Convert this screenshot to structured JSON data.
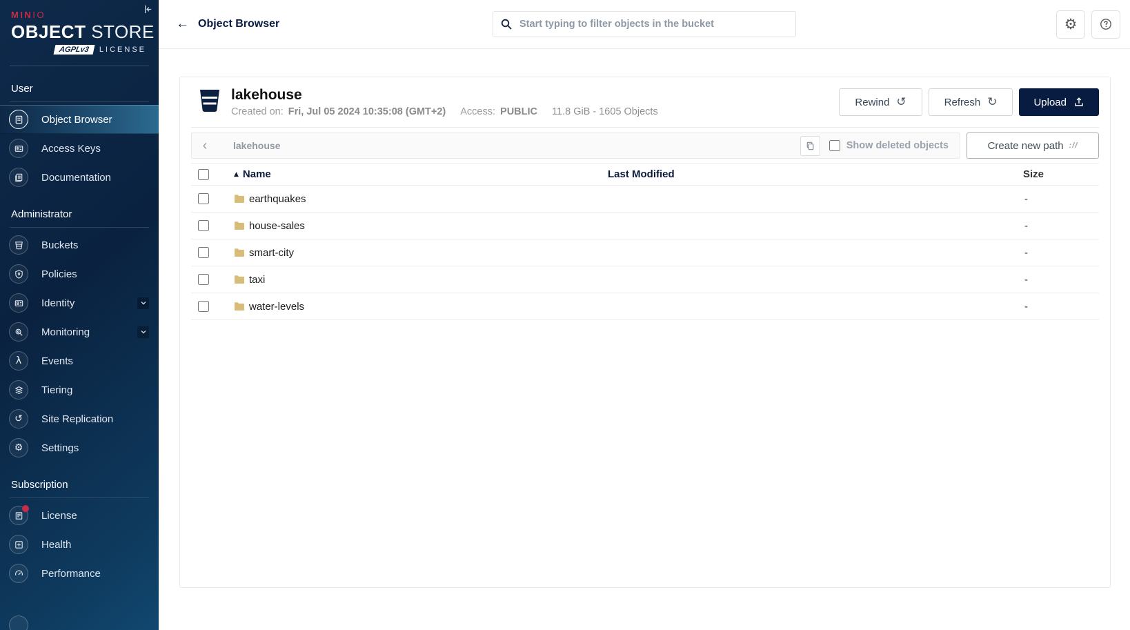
{
  "brand": {
    "name_bold": "MIN",
    "name_light": "IO",
    "title_primary": "OBJECT",
    "title_secondary": "STORE",
    "badge": "AGPLv3",
    "license": "LICENSE"
  },
  "colors": {
    "accent_red": "#c72c48",
    "navy": "#081c42",
    "sidebar_active": "#2c6a90",
    "folder": "#d8bc7a"
  },
  "sidebar": {
    "sections": [
      {
        "label": "User",
        "items": [
          {
            "label": "Object Browser",
            "icon": "object-browser-icon",
            "active": true
          },
          {
            "label": "Access Keys",
            "icon": "access-keys-icon"
          },
          {
            "label": "Documentation",
            "icon": "documentation-icon"
          }
        ]
      },
      {
        "label": "Administrator",
        "items": [
          {
            "label": "Buckets",
            "icon": "buckets-icon"
          },
          {
            "label": "Policies",
            "icon": "policies-icon"
          },
          {
            "label": "Identity",
            "icon": "identity-icon",
            "expandable": true
          },
          {
            "label": "Monitoring",
            "icon": "monitoring-icon",
            "expandable": true
          },
          {
            "label": "Events",
            "icon": "events-icon"
          },
          {
            "label": "Tiering",
            "icon": "tiering-icon"
          },
          {
            "label": "Site Replication",
            "icon": "site-replication-icon"
          },
          {
            "label": "Settings",
            "icon": "settings-icon"
          }
        ]
      },
      {
        "label": "Subscription",
        "items": [
          {
            "label": "License",
            "icon": "license-icon",
            "notification": true
          },
          {
            "label": "Health",
            "icon": "health-icon"
          },
          {
            "label": "Performance",
            "icon": "performance-icon"
          }
        ]
      }
    ]
  },
  "topbar": {
    "title": "Object Browser",
    "back_icon": "back-arrow-icon",
    "search_placeholder": "Start typing to filter objects in the bucket",
    "icons": [
      "search-icon",
      "gear-icon",
      "help-icon"
    ]
  },
  "bucket": {
    "name": "lakehouse",
    "created_label": "Created on:",
    "created_value": "Fri, Jul 05 2024 10:35:08 (GMT+2)",
    "access_label": "Access:",
    "access_value": "PUBLIC",
    "summary": "11.8 GiB - 1605 Objects"
  },
  "actions": {
    "rewind": "Rewind",
    "refresh": "Refresh",
    "upload": "Upload",
    "show_deleted": "Show deleted objects",
    "create_path": "Create new path"
  },
  "pathbar": {
    "current": "lakehouse"
  },
  "table": {
    "columns": [
      "Name",
      "Last Modified",
      "Size"
    ],
    "rows": [
      {
        "name": "earthquakes",
        "last_modified": "",
        "size": "-"
      },
      {
        "name": "house-sales",
        "last_modified": "",
        "size": "-"
      },
      {
        "name": "smart-city",
        "last_modified": "",
        "size": "-"
      },
      {
        "name": "taxi",
        "last_modified": "",
        "size": "-"
      },
      {
        "name": "water-levels",
        "last_modified": "",
        "size": "-"
      }
    ]
  }
}
